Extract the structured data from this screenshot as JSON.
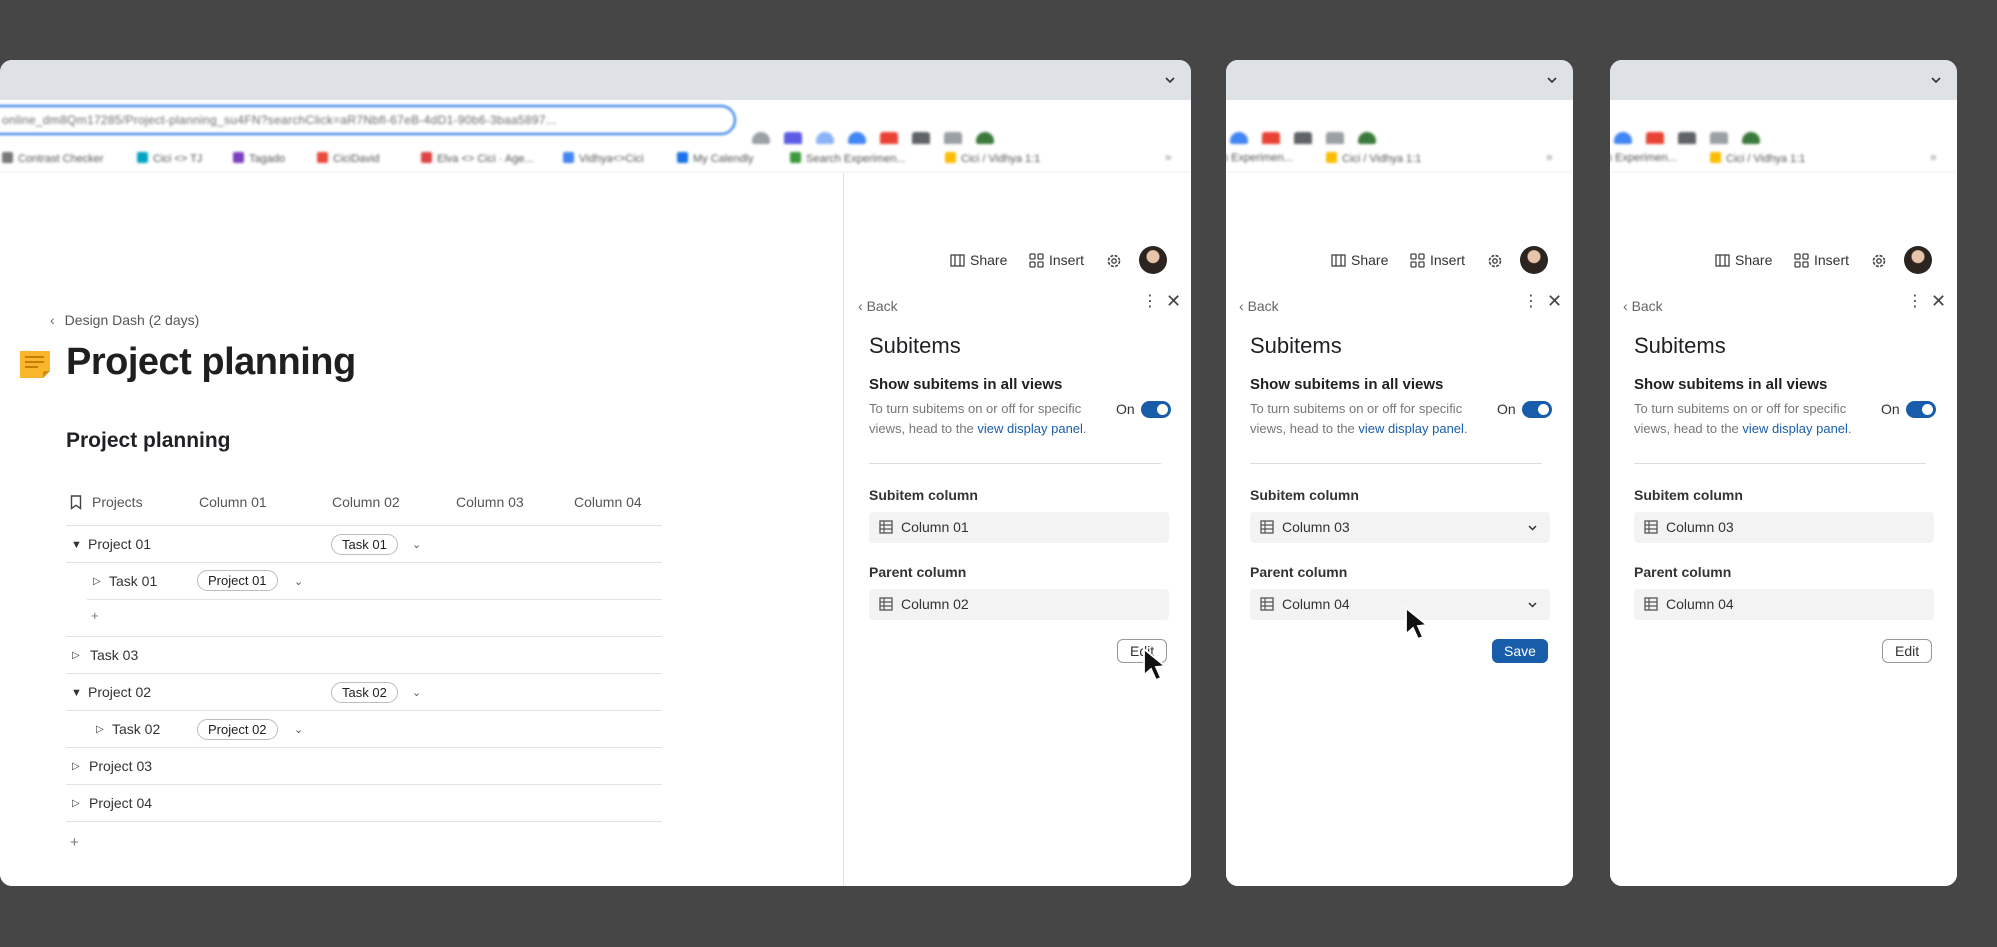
{
  "browser": {
    "url": "online_dm8Qm17285/Project-planning_su4FN?searchClick=aR7Nbfl-67eB-4dD1-90b6-3baa5897...",
    "bookmarks": [
      "Contrast Checker",
      "Cici <> TJ",
      "Tagado",
      "CiciDavid",
      "Elva <> Cici · Age...",
      "Vidhya<>Cici",
      "My Calendly",
      "Search Experimen...",
      "Cici / Vidhya 1:1"
    ],
    "bookmarks_short": [
      "h Experimen...",
      "Cici / Vidhya 1:1"
    ],
    "bookmarks_more": "»"
  },
  "doc": {
    "breadcrumb": "Design Dash (2 days)",
    "title": "Project planning",
    "table_title": "Project planning",
    "columns": [
      "Projects",
      "Column 01",
      "Column 02",
      "Column 03",
      "Column 04"
    ],
    "rows": [
      {
        "label": "Project 01",
        "chip": "Task 01"
      },
      {
        "label": "Task 01",
        "chip": "Project 01"
      },
      {
        "label": "+"
      },
      {
        "label": "Task 03"
      },
      {
        "label": "Project 02",
        "chip": "Task 02"
      },
      {
        "label": "Task 02",
        "chip": "Project 02"
      },
      {
        "label": "Project 03"
      },
      {
        "label": "Project 04"
      }
    ],
    "add": "+"
  },
  "panel": {
    "share": "Share",
    "insert": "Insert",
    "back": "Back",
    "title": "Subitems",
    "show_label": "Show subitems in all views",
    "desc_prefix": "To turn subitems on or off for specific views, head to the ",
    "desc_link": "view display panel",
    "desc_suffix": ".",
    "on": "On",
    "subitem_label": "Subitem column",
    "parent_label": "Parent column",
    "edit": "Edit",
    "save": "Save"
  },
  "states": [
    {
      "subitem": "Column 01",
      "parent": "Column 02",
      "button": "Edit"
    },
    {
      "subitem": "Column 03",
      "parent": "Column 04",
      "button": "Save"
    },
    {
      "subitem": "Column 03",
      "parent": "Column 04",
      "button": "Edit"
    }
  ],
  "colors": {
    "background": "#464646",
    "accent": "#175da9",
    "url_focus": "#1a73e8"
  },
  "icons": [
    "chevron-down-icon",
    "share-icon",
    "insert-icon",
    "gear-icon",
    "avatar",
    "kebab-icon",
    "close-icon",
    "table-icon",
    "bookmark-icon",
    "cursor-icon"
  ]
}
